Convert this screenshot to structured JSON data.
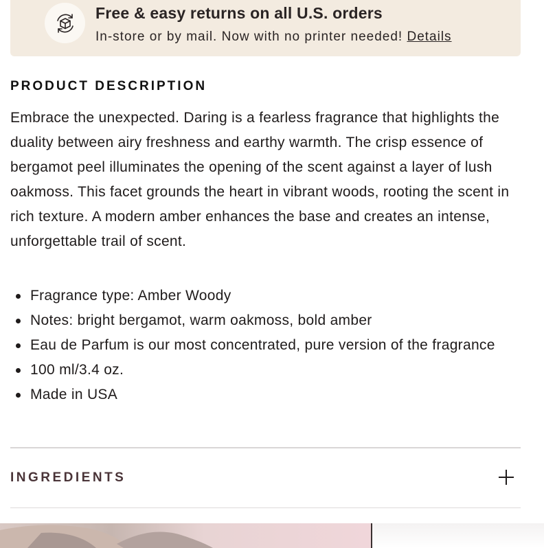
{
  "returns_banner": {
    "icon": "returns-box-icon",
    "title": "Free & easy returns on all U.S. orders",
    "subtitle": "In-store or by mail. Now with no printer needed!",
    "details_link": "Details"
  },
  "product_description": {
    "heading": "PRODUCT DESCRIPTION",
    "body": "Embrace the unexpected. Daring is a fearless fragrance that highlights the duality between airy freshness and earthy warmth. The crisp essence of bergamot peel illuminates the opening of the scent against a layer of lush oakmoss. This facet grounds the heart in vibrant woods, rooting the scent in rich texture. A modern amber enhances the base and creates an intense, unforgettable trail of scent.",
    "bullets": [
      "Fragrance type: Amber Woody",
      "Notes: bright bergamot, warm oakmoss, bold amber",
      "Eau de Parfum is our most concentrated, pure version of the fragrance",
      "100 ml/3.4 oz.",
      "Made in USA"
    ]
  },
  "ingredients": {
    "label": "INGREDIENTS",
    "toggle_icon": "plus-icon"
  },
  "colors": {
    "banner_bg": "#f3ebe0",
    "ingredients_label": "#4a3438"
  }
}
